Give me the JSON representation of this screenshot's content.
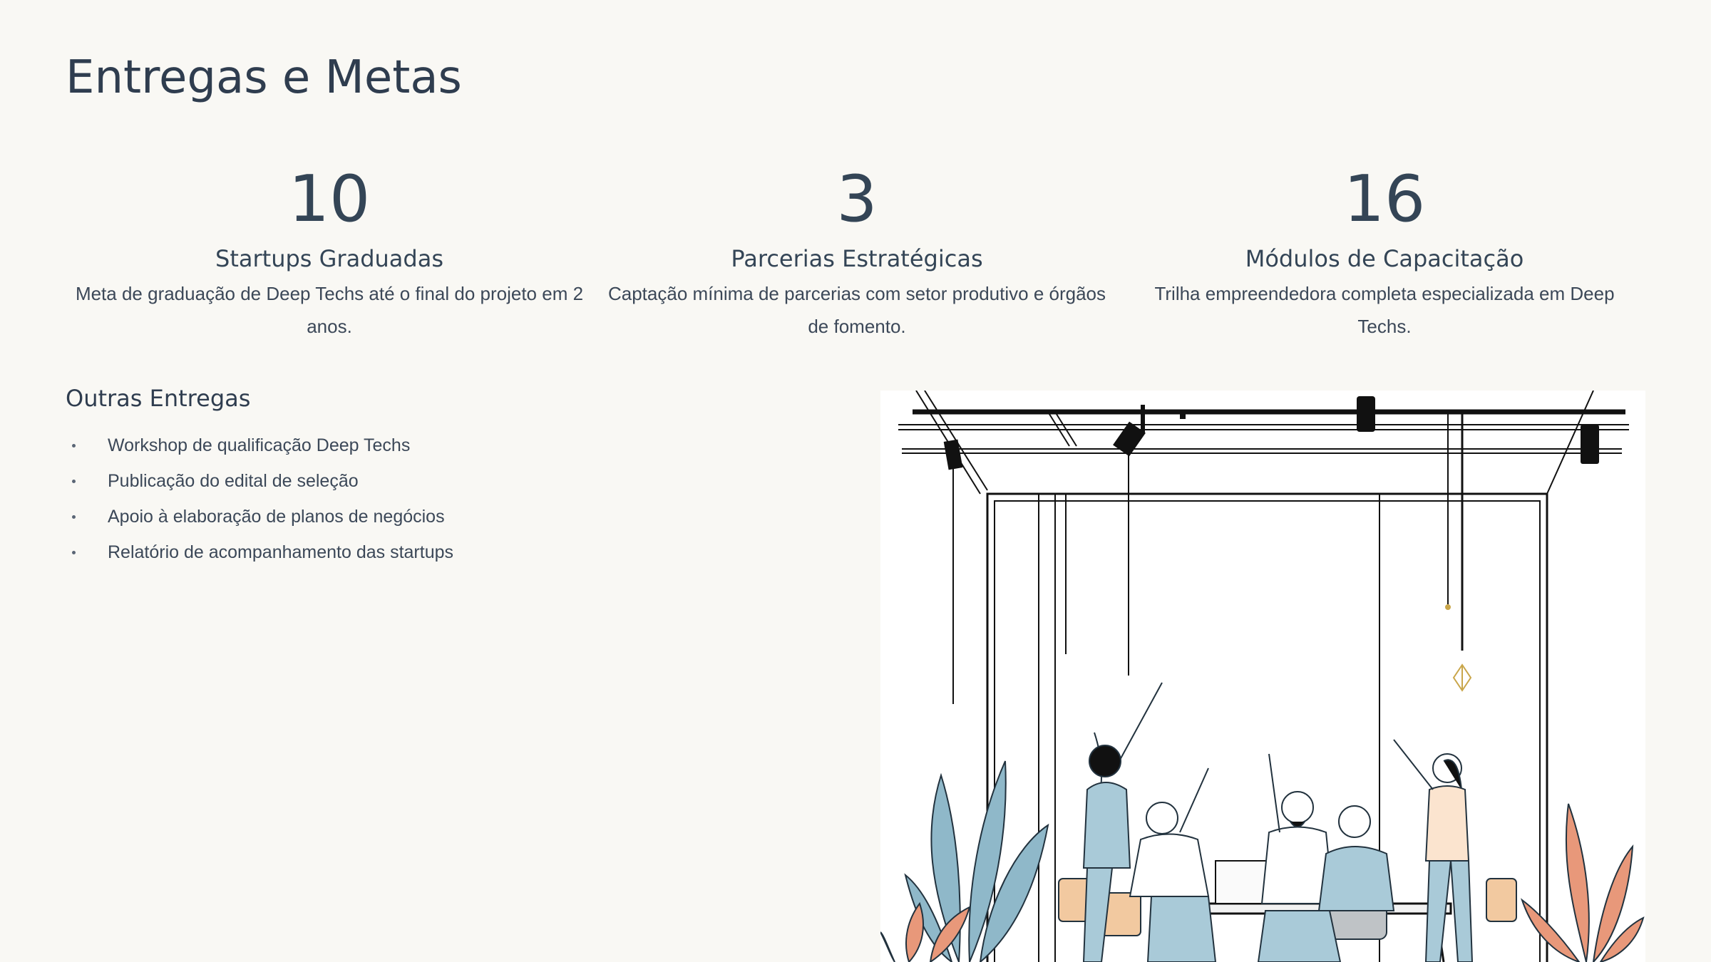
{
  "slide": {
    "title": "Entregas e Metas"
  },
  "stats": [
    {
      "value": "10",
      "label": "Startups Graduadas",
      "description": "Meta de graduação de Deep Techs até o final do projeto em 2 anos."
    },
    {
      "value": "3",
      "label": "Parcerias Estratégicas",
      "description": "Captação mínima de parcerias com setor produtivo e órgãos de fomento."
    },
    {
      "value": "16",
      "label": "Módulos de Capacitação",
      "description": "Trilha empreendedora completa especializada em Deep Techs."
    }
  ],
  "others": {
    "title": "Outras Entregas",
    "items": [
      "Workshop de qualificação Deep Techs",
      "Publicação do edital de seleção",
      "Apoio à elaboração de planos de negócios",
      "Relatório de acompanhamento das startups"
    ]
  },
  "colors": {
    "background": "#f9f8f4",
    "text": "#2d3a4a",
    "plant_blue": "#8fb8c9",
    "plant_orange": "#e8987a",
    "shirt_blue": "#a9cad8"
  },
  "illustration": {
    "icon": "coworking-celebration-illustration"
  }
}
